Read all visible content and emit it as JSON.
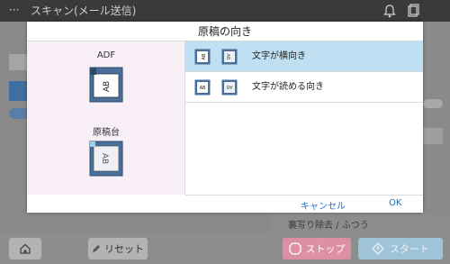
{
  "app": {
    "title": "スキャン(メール送信)",
    "menu_glyph": "···",
    "ghost_status": "裏写り除去 / ふつう"
  },
  "dialog": {
    "title": "原稿の向き",
    "left": {
      "adf_label": "ADF",
      "platen_label": "原稿台"
    },
    "options": [
      {
        "label": "文字が横向き",
        "selected": true
      },
      {
        "label": "文字が読める向き",
        "selected": false
      }
    ],
    "cancel_label": "キャンセル",
    "ok_label": "OK"
  },
  "bottom_bar": {
    "reset_label": "リセット",
    "stop_label": "ストップ",
    "start_label": "スタート"
  },
  "colors": {
    "selected_row": "#bfe0f2",
    "left_pane": "#f8eff6",
    "link": "#1a73c8",
    "stop": "#dd8fa3",
    "start": "#9fc3d8"
  },
  "icons": [
    "bell-icon",
    "cart-icon",
    "home-icon",
    "pencil-icon",
    "stop-icon",
    "start-icon",
    "document-icon"
  ]
}
